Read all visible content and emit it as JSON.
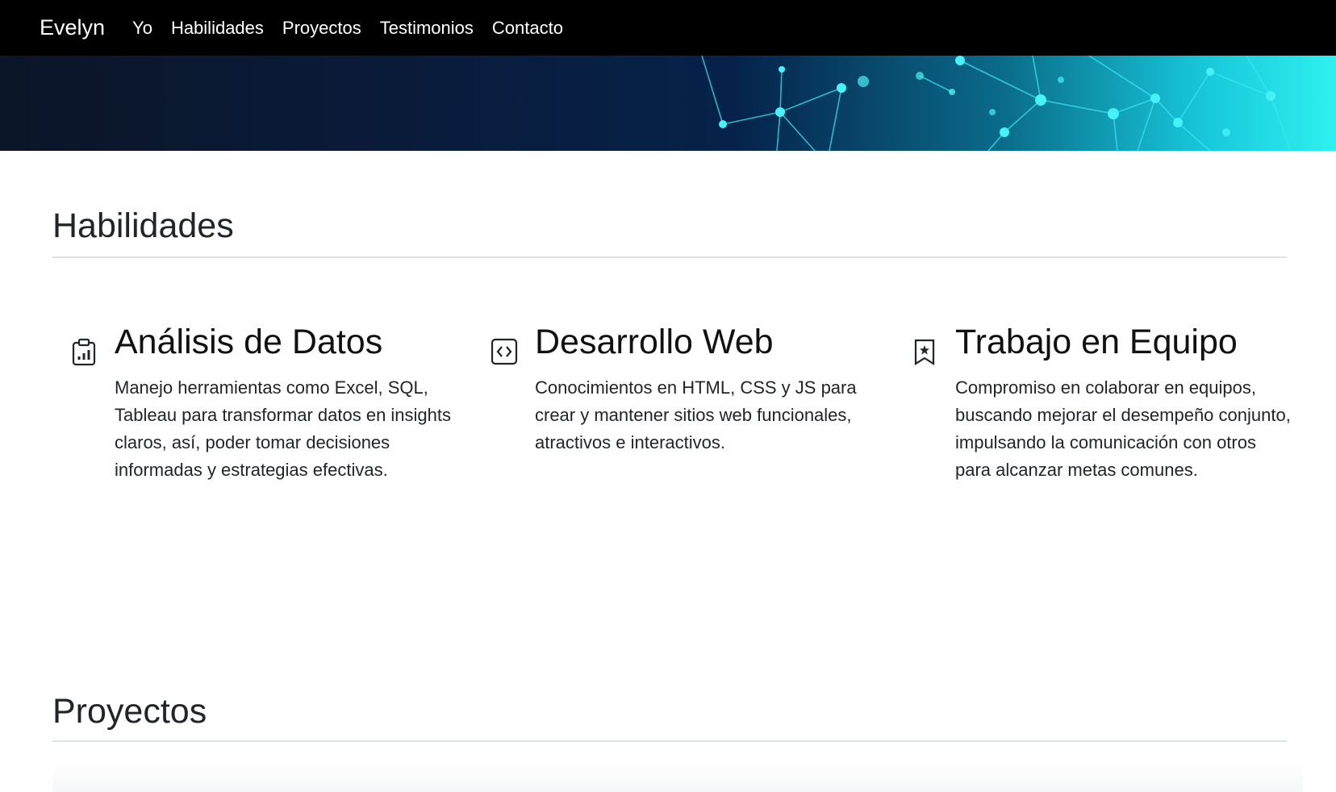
{
  "nav": {
    "brand": "Evelyn",
    "links": [
      "Yo",
      "Habilidades",
      "Proyectos",
      "Testimonios",
      "Contacto"
    ]
  },
  "skills_section": {
    "title": "Habilidades",
    "items": [
      {
        "icon": "clipboard-data-icon",
        "title": "Análisis de Datos",
        "description": "Manejo herramientas como Excel, SQL, Tableau para transformar datos en insights claros, así, poder tomar decisiones informadas y estrategias efectivas."
      },
      {
        "icon": "code-square-icon",
        "title": "Desarrollo Web",
        "description": "Conocimientos en HTML, CSS y JS para crear y mantener sitios web funcionales, atractivos e interactivos."
      },
      {
        "icon": "bookmark-star-icon",
        "title": "Trabajo en Equipo",
        "description": "Compromiso en colaborar en equipos, buscando mejorar el desempeño conjunto, impulsando la comunicación con otros para alcanzar metas comunes."
      }
    ]
  },
  "projects_section": {
    "title": "Proyectos"
  },
  "colors": {
    "navbar": "#000000",
    "hero_dark": "#0a1b3a",
    "hero_accent": "#2ff0f0",
    "text": "#212529",
    "divider": "#dee2e6"
  }
}
